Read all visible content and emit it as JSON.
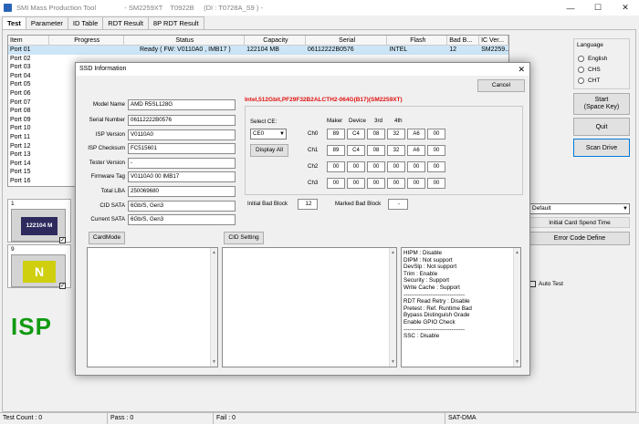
{
  "window": {
    "title": "SMI Mass Production Tool               - SM2259XT    T0922B     (DI : T0728A_S9 ) -",
    "minimize": "—",
    "maximize": "☐",
    "close": "✕"
  },
  "tabs": [
    "Test",
    "Parameter",
    "ID Table",
    "RDT Result",
    "8P RDT Result"
  ],
  "port_list": {
    "headers": [
      "Item",
      "Progress",
      "Status",
      "Capacity",
      "Serial",
      "Flash",
      "Bad B...",
      "IC Ver..."
    ],
    "rows": [
      [
        "Port 01",
        "",
        "Ready ( FW: V0110A0 , IMB17 )",
        "122104 MB",
        "06112222B0576",
        "INTEL",
        "12",
        "SM2259..."
      ],
      [
        "Port 02",
        "",
        "",
        "",
        "",
        "",
        "",
        ""
      ],
      [
        "Port 03",
        "",
        "",
        "",
        "",
        "",
        "",
        ""
      ],
      [
        "Port 04",
        "",
        "",
        "",
        "",
        "",
        "",
        ""
      ],
      [
        "Port 05",
        "",
        "",
        "",
        "",
        "",
        "",
        ""
      ],
      [
        "Port 06",
        "",
        "",
        "",
        "",
        "",
        "",
        ""
      ],
      [
        "Port 07",
        "",
        "",
        "",
        "",
        "",
        "",
        ""
      ],
      [
        "Port 08",
        "",
        "",
        "",
        "",
        "",
        "",
        ""
      ],
      [
        "Port 09",
        "",
        "",
        "",
        "",
        "",
        "",
        ""
      ],
      [
        "Port 10",
        "",
        "",
        "",
        "",
        "",
        "",
        ""
      ],
      [
        "Port 11",
        "",
        "",
        "",
        "",
        "",
        "",
        ""
      ],
      [
        "Port 12",
        "",
        "",
        "",
        "",
        "",
        "",
        ""
      ],
      [
        "Port 13",
        "",
        "",
        "",
        "",
        "",
        "",
        ""
      ],
      [
        "Port 14",
        "",
        "",
        "",
        "",
        "",
        "",
        ""
      ],
      [
        "Port 15",
        "",
        "",
        "",
        "",
        "",
        "",
        ""
      ],
      [
        "Port 16",
        "",
        "",
        "",
        "",
        "",
        "",
        ""
      ]
    ]
  },
  "slots": [
    {
      "number": "1",
      "image_text": "122104 M"
    },
    {
      "number": "9",
      "image_text": "N"
    }
  ],
  "isp_label": "ISP",
  "right_panel": {
    "language_title": "Language",
    "languages": [
      "English",
      "CHS",
      "CHT"
    ],
    "start": "Start\n(Space Key)",
    "quit": "Quit",
    "scan_drive": "Scan Drive",
    "mode_select": "Default",
    "initial_card_spend_time": "Initial Card Spend Time",
    "error_code_define": "Error Code Define",
    "auto_test": "Auto Test"
  },
  "status_bar": {
    "test_count": "Test Count : 0",
    "pass": "Pass : 0",
    "fail": "Fail : 0",
    "interface": "SAT-DMA"
  },
  "dialog": {
    "title": "SSD Information",
    "close": "✕",
    "cancel": "Cancel",
    "fields": [
      {
        "label": "Model Name",
        "value": "AMD R5SL128G"
      },
      {
        "label": "Serial Number",
        "value": "06112222B0576"
      },
      {
        "label": "ISP Version",
        "value": "V0110A0"
      },
      {
        "label": "ISP Checksum",
        "value": "FC515601"
      },
      {
        "label": "Tester Version",
        "value": "-"
      },
      {
        "label": "Firmware Tag",
        "value": "V0110A0 00 IMB17"
      },
      {
        "label": "Total LBA",
        "value": "250069680"
      },
      {
        "label": "CID SATA",
        "value": "6Gb/S, Gen3"
      },
      {
        "label": "Current SATA",
        "value": "6Gb/S, Gen3"
      }
    ],
    "flash_info": "Intel,512Gbit,PF29F32B2ALCTH2-064G(B17)(SM2259XT)",
    "select_ce_label": "Select CE:",
    "select_ce_value": "CE0",
    "display_all": "Display All",
    "ce_headers": [
      "Maker",
      "Device",
      "3rd",
      "4th"
    ],
    "channels": [
      {
        "name": "Ch0",
        "values": [
          "89",
          "C4",
          "08",
          "32",
          "A6",
          "00"
        ]
      },
      {
        "name": "Ch1",
        "values": [
          "89",
          "C4",
          "08",
          "32",
          "A6",
          "00"
        ]
      },
      {
        "name": "Ch2",
        "values": [
          "00",
          "00",
          "00",
          "00",
          "00",
          "00"
        ]
      },
      {
        "name": "Ch3",
        "values": [
          "00",
          "00",
          "00",
          "00",
          "00",
          "00"
        ]
      }
    ],
    "initial_bad_block_label": "Initial Bad Block",
    "initial_bad_block_value": "12",
    "marked_bad_block_label": "Marked Bad Block",
    "marked_bad_block_value": "-",
    "card_mode": "CardMode",
    "cid_setting": "CID Setting",
    "features": [
      "HIPM : Disable",
      "DIPM : Not support",
      "DevSlp : Not support",
      "Trim : Enable",
      "Security : Support",
      "Write Cache : Support",
      "--------------------------------",
      "RDT Read Retry : Disable",
      "Pretest : Ref. Runtime Bad",
      "Bypass Distinguish Grade",
      "Enable GPIO Check",
      "--------------------------------",
      "SSC : Disable"
    ]
  }
}
